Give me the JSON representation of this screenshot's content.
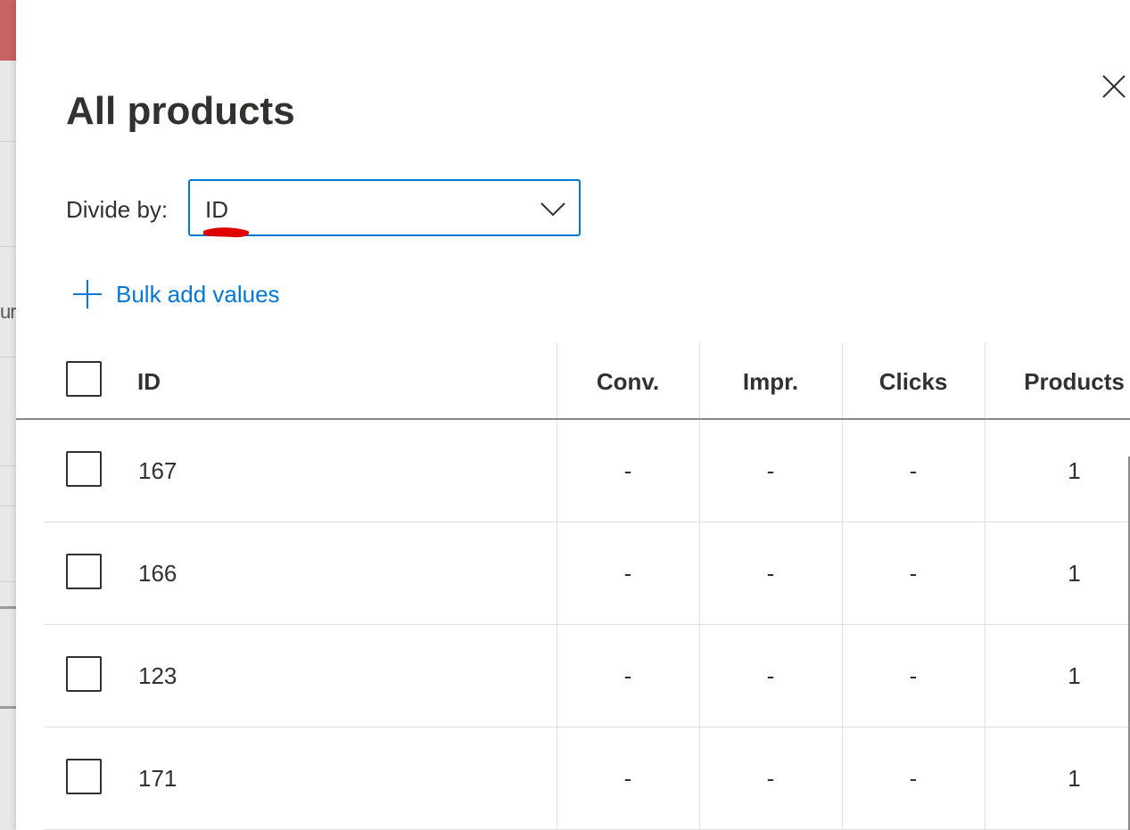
{
  "background": {
    "fragment_text": "ur",
    "accent_color": "#c86464"
  },
  "panel": {
    "title": "All products",
    "close_icon": "close-icon"
  },
  "divide": {
    "label": "Divide by:",
    "selected": "ID",
    "chevron_icon": "chevron-down-icon"
  },
  "bulk_add": {
    "icon": "plus-icon",
    "label": "Bulk add values"
  },
  "table": {
    "columns": [
      "ID",
      "Conv.",
      "Impr.",
      "Clicks",
      "Products"
    ],
    "rows": [
      {
        "id": "167",
        "conv": "-",
        "impr": "-",
        "clicks": "-",
        "products": "1"
      },
      {
        "id": "166",
        "conv": "-",
        "impr": "-",
        "clicks": "-",
        "products": "1"
      },
      {
        "id": "123",
        "conv": "-",
        "impr": "-",
        "clicks": "-",
        "products": "1"
      },
      {
        "id": "171",
        "conv": "-",
        "impr": "-",
        "clicks": "-",
        "products": "1"
      }
    ]
  },
  "colors": {
    "accent": "#0078d4",
    "text": "#323130",
    "annotation": "#e00000"
  }
}
